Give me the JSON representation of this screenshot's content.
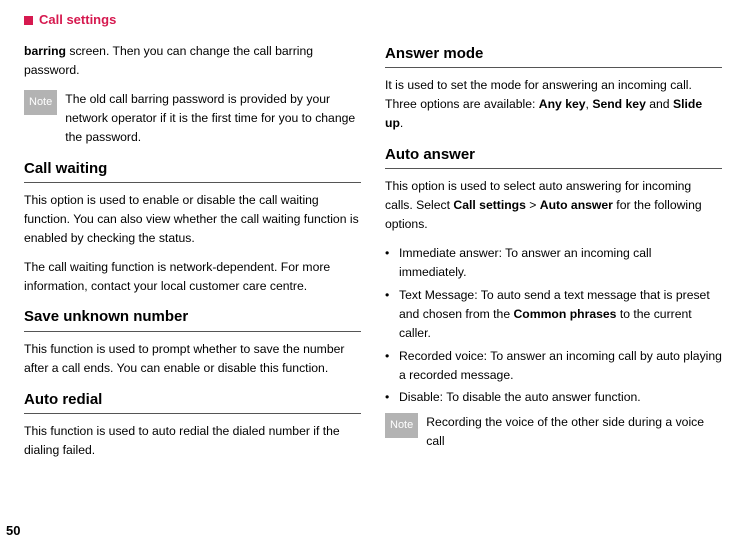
{
  "header": {
    "section_title": "Call settings"
  },
  "left": {
    "barring_para_prefix": "barring",
    "barring_para_rest": " screen. Then you can change the call barring password.",
    "note1_label": "Note",
    "note1_text": "The old call barring password is provided by your network operator if it is the first time for you to change the password.",
    "h_call_waiting": "Call waiting",
    "call_waiting_p1": "This option is used to enable or disable the call wait­ing function. You can also view whether the call wait­ing function is enabled by checking the status.",
    "call_waiting_p2": "The call waiting function is network-dependent. For more information, contact your local customer care centre.",
    "h_save_unknown": "Save unknown number",
    "save_unknown_p": "This function is used to prompt whether to save the number after a call ends. You can enable or disable this function.",
    "h_auto_redial": "Auto redial",
    "auto_redial_p": "This function is used to auto redial the dialed number if the dialing failed."
  },
  "right": {
    "h_answer_mode": "Answer mode",
    "answer_mode_p_pre": "It is used to set the mode for answering an incoming call. Three options are available: ",
    "answer_mode_any": "Any key",
    "answer_mode_sep1": ", ",
    "answer_mode_send": "Send key",
    "answer_mode_sep2": " and ",
    "answer_mode_slide": "Slide up",
    "answer_mode_end": ".",
    "h_auto_answer": "Auto answer",
    "auto_answer_p_pre": "This option is used to select auto answering for incoming calls. Select ",
    "auto_answer_b1": "Call settings",
    "auto_answer_gt": " > ",
    "auto_answer_b2": "Auto answer",
    "auto_answer_post": " for the following options.",
    "bullets": {
      "b1": "Immediate answer: To answer an incoming call immediately.",
      "b2_pre": "Text Message: To auto send a text message that is preset and chosen from the ",
      "b2_bold": "Common phrases",
      "b2_post": " to the current caller.",
      "b3": "Recorded voice: To answer an incoming call by auto playing a recorded message.",
      "b4": "Disable: To disable the auto answer function."
    },
    "note2_label": "Note",
    "note2_text": "Recording the voice of the other side during a voice call"
  },
  "page_number": "50"
}
